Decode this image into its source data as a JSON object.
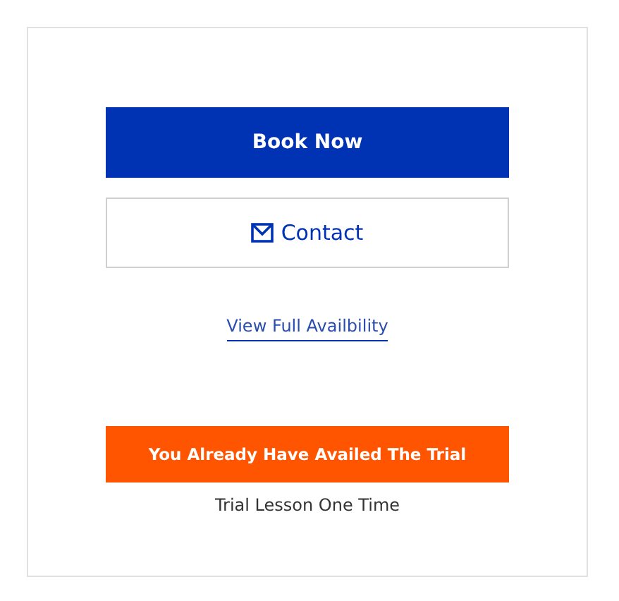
{
  "book_button": {
    "label": "Book Now"
  },
  "contact_button": {
    "label": "Contact"
  },
  "availability_link": {
    "label": "View Full Availbility"
  },
  "trial_notice": {
    "label": "You Already Have Availed The Trial"
  },
  "trial_note": "Trial Lesson One Time"
}
